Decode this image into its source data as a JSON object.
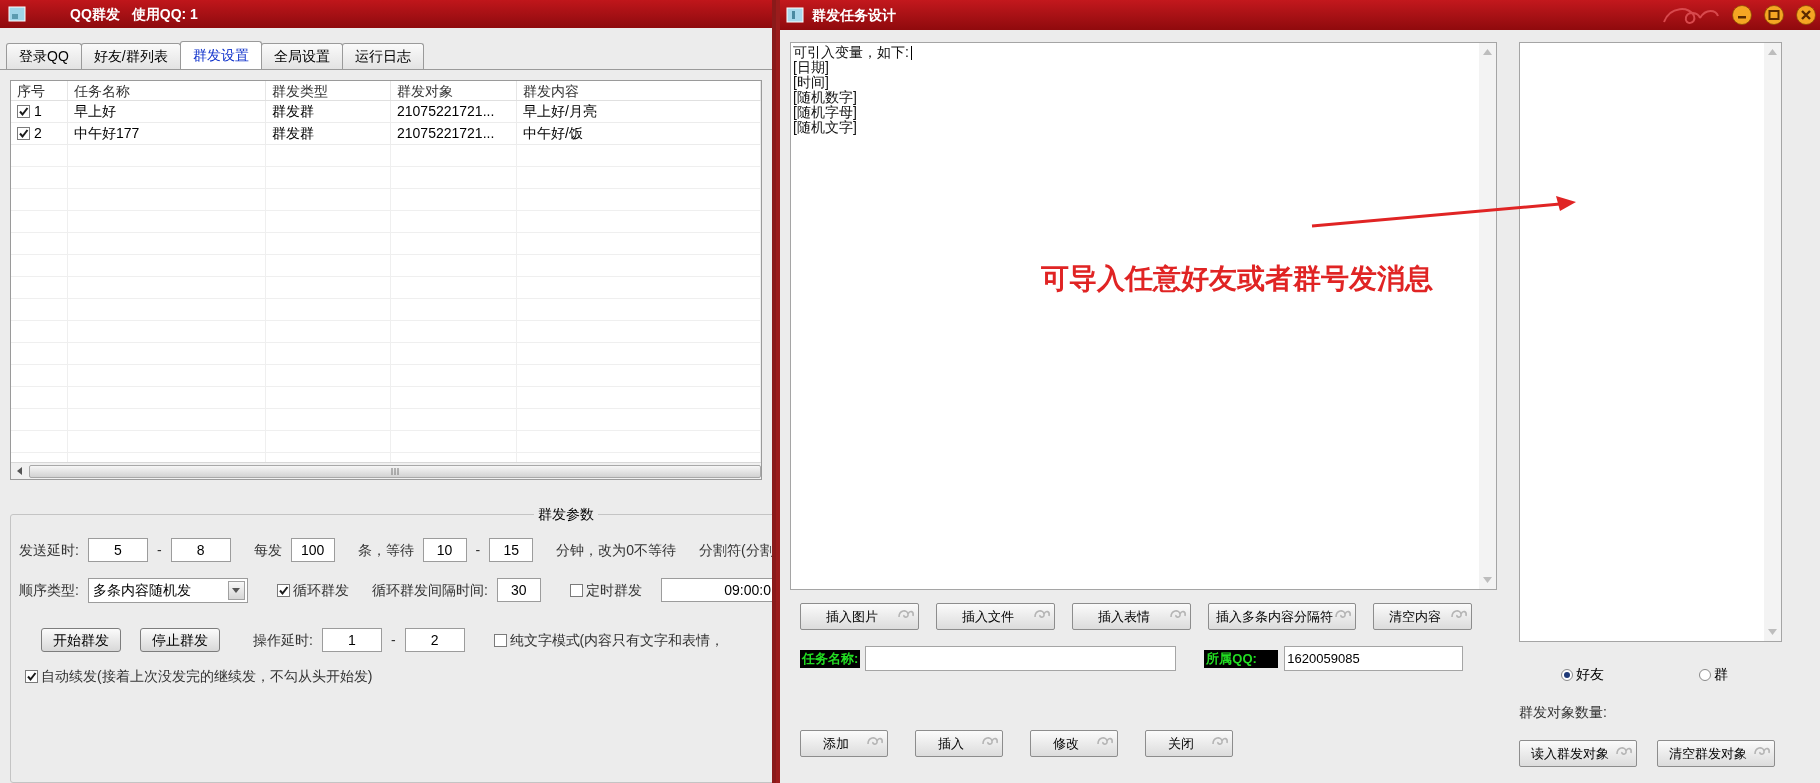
{
  "main_window": {
    "title": "QQ群发",
    "title_qq": "使用QQ: 1",
    "tabs": [
      {
        "label": "登录QQ",
        "selected": false
      },
      {
        "label": "好友/群列表",
        "selected": false
      },
      {
        "label": "群发设置",
        "selected": true
      },
      {
        "label": "全局设置",
        "selected": false
      },
      {
        "label": "运行日志",
        "selected": false
      }
    ],
    "table": {
      "columns": [
        "序号",
        "任务名称",
        "群发类型",
        "群发对象",
        "群发内容"
      ],
      "rows": [
        {
          "checked": true,
          "cells": [
            "1",
            "早上好",
            "群发群",
            "21075221721...",
            "早上好/月亮"
          ]
        },
        {
          "checked": true,
          "cells": [
            "2",
            "中午好177",
            "群发群",
            "21075221721...",
            "中午好/饭"
          ]
        }
      ]
    },
    "params": {
      "title": "群发参数",
      "lines": [
        {
          "items": [
            {
              "kind": "label",
              "text": "发送延时:"
            },
            {
              "kind": "input",
              "value": "5"
            },
            {
              "kind": "dash",
              "text": "-"
            },
            {
              "kind": "input",
              "value": "8"
            },
            {
              "kind": "label",
              "text": "每发"
            },
            {
              "kind": "small_input",
              "value": "100"
            },
            {
              "kind": "label",
              "text": "条，等待"
            },
            {
              "kind": "small_input",
              "value": "10"
            },
            {
              "kind": "dash",
              "text": "-"
            },
            {
              "kind": "small_input",
              "value": "15"
            },
            {
              "kind": "label",
              "text": "分钟，改为0不等待"
            },
            {
              "kind": "label",
              "text": "分割符(分割"
            }
          ]
        },
        {
          "items": [
            {
              "kind": "label",
              "text": "顺序类型:"
            },
            {
              "kind": "select",
              "value": "多条内容随机发"
            },
            {
              "kind": "checkbox",
              "text": "循环群发",
              "checked": true
            },
            {
              "kind": "label",
              "text": "循环群发间隔时间:"
            },
            {
              "kind": "small_input",
              "value": "30"
            },
            {
              "kind": "checkbox",
              "text": "定时群发",
              "checked": false
            },
            {
              "kind": "edge_input",
              "value": "09:00:0"
            }
          ]
        },
        {
          "items": [
            {
              "kind": "button",
              "text": "开始群发"
            },
            {
              "kind": "button",
              "text": "停止群发"
            },
            {
              "kind": "label",
              "text": "操作延时:"
            },
            {
              "kind": "input",
              "value": "1"
            },
            {
              "kind": "dash",
              "text": "-"
            },
            {
              "kind": "input",
              "value": "2"
            },
            {
              "kind": "checkbox",
              "text": "纯文字模式(内容只有文字和表情，",
              "checked": false
            }
          ]
        },
        {
          "items": [
            {
              "kind": "checkbox",
              "text": "自动续发(接着上次没发完的继续发，不勾从头开始发)",
              "checked": true
            }
          ]
        }
      ]
    }
  },
  "task_window": {
    "title": "群发任务设计",
    "editor_lines": [
      "可引入变量，如下:",
      "[日期]",
      "[时间]",
      "[随机数字]",
      "[随机字母]",
      "[随机文字]"
    ],
    "insert_buttons": [
      "插入图片",
      "插入文件",
      "插入表情",
      "插入多条内容分隔符",
      "清空内容"
    ],
    "task_name_label": "任务名称:",
    "owner_qq_label": "所属QQ:",
    "owner_qq": "1620059085",
    "action_buttons": [
      "添加",
      "插入",
      "修改",
      "关闭"
    ],
    "target_types": [
      {
        "label": "好友",
        "selected": true
      },
      {
        "label": "群",
        "selected": false
      }
    ],
    "target_count_label": "群发对象数量:",
    "target_buttons": [
      "读入群发对象",
      "清空群发对象"
    ],
    "annotation": "可导入任意好友或者群号发消息"
  }
}
